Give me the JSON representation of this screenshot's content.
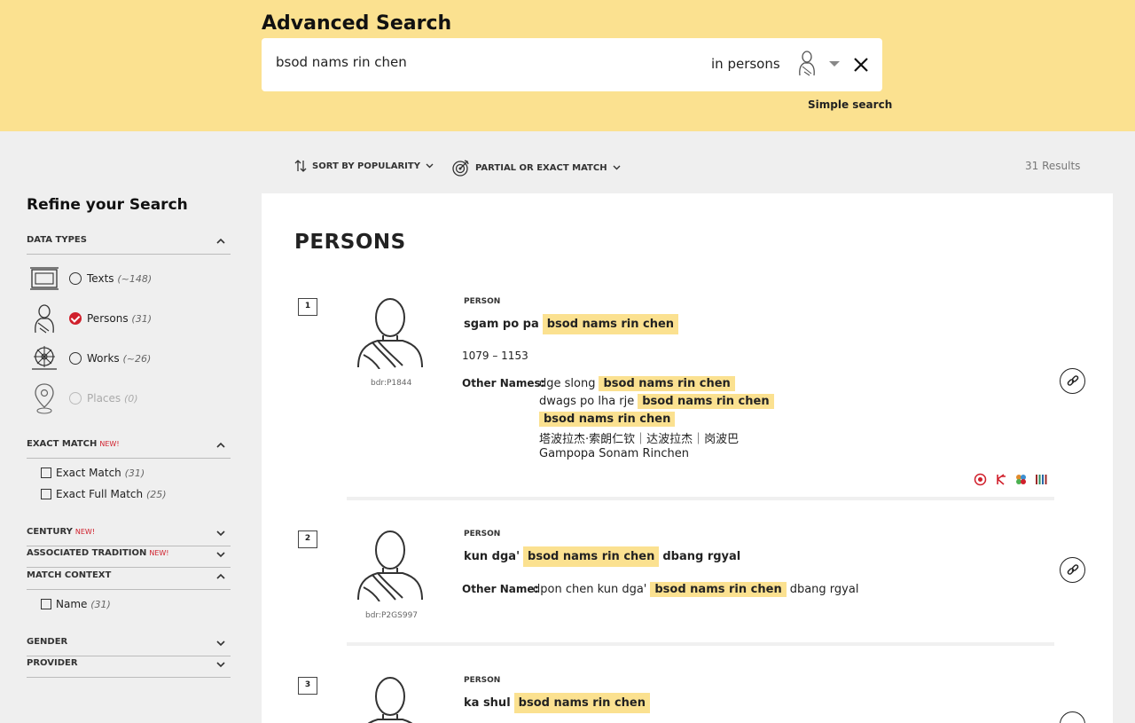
{
  "header": {
    "title": "Advanced Search",
    "search_value": "bsod nams rin chen",
    "scope_label": "in persons",
    "simple_search_label": "Simple search"
  },
  "toolbar": {
    "sort_label": "SORT BY POPULARITY",
    "match_label": "PARTIAL OR EXACT MATCH",
    "results_count": "31 Results"
  },
  "sidebar": {
    "title": "Refine your Search",
    "data_types": {
      "heading": "DATA TYPES",
      "items": [
        {
          "label": "Texts",
          "count": "(~148)"
        },
        {
          "label": "Persons",
          "count": "(31)"
        },
        {
          "label": "Works",
          "count": "(~26)"
        },
        {
          "label": "Places",
          "count": "(0)"
        }
      ]
    },
    "exact_match": {
      "heading": "EXACT MATCH",
      "new_badge": "NEW!",
      "items": [
        {
          "label": "Exact Match",
          "count": "(31)"
        },
        {
          "label": "Exact Full Match",
          "count": "(25)"
        }
      ]
    },
    "century": {
      "heading": "CENTURY",
      "new_badge": "NEW!"
    },
    "tradition": {
      "heading": "ASSOCIATED TRADITION",
      "new_badge": "NEW!"
    },
    "match_context": {
      "heading": "MATCH CONTEXT",
      "items": [
        {
          "label": "Name",
          "count": "(31)"
        }
      ]
    },
    "gender": {
      "heading": "GENDER"
    },
    "provider": {
      "heading": "PROVIDER"
    }
  },
  "results": {
    "section_title": "PERSONS",
    "items": [
      {
        "number": "1",
        "id": "bdr:P1844",
        "kind": "PERSON",
        "name_prefix": "sgam po pa",
        "name_highlight": "bsod nams rin chen",
        "dates": "1079 – 1153",
        "other_names_label": "Other Names:",
        "other_names": [
          {
            "prefix": "dge slong",
            "highlight": "bsod nams rin chen"
          },
          {
            "prefix": "dwags po lha rje",
            "highlight": "bsod nams rin chen"
          },
          {
            "prefix": "",
            "highlight": "bsod nams rin chen"
          },
          {
            "text": "塔波拉杰·索朗仁钦｜达波拉杰｜岗波巴"
          },
          {
            "text": "Gampopa Sonam Rinchen"
          }
        ]
      },
      {
        "number": "2",
        "id": "bdr:P2GS997",
        "kind": "PERSON",
        "name_prefix": "kun dga'",
        "name_highlight": "bsod nams rin chen",
        "name_suffix": "dbang rgyal",
        "other_names_label": "Other Name:",
        "other_name_prefix": "dpon chen kun dga'",
        "other_name_highlight": "bsod nams rin chen",
        "other_name_suffix": "dbang rgyal"
      },
      {
        "number": "3",
        "kind": "PERSON",
        "name_prefix": "ka shul",
        "name_highlight": "bsod nams rin chen"
      }
    ]
  },
  "colors": {
    "header_bg": "#fbe190",
    "highlight": "#fbe190",
    "accent_red": "#d0202c",
    "page_bg": "#efefef"
  },
  "icons": [
    "person-icon",
    "caret-down-icon",
    "close-icon",
    "sort-icon",
    "target-icon",
    "chevron-icon",
    "text-icon",
    "work-icon",
    "place-icon",
    "link-icon"
  ]
}
